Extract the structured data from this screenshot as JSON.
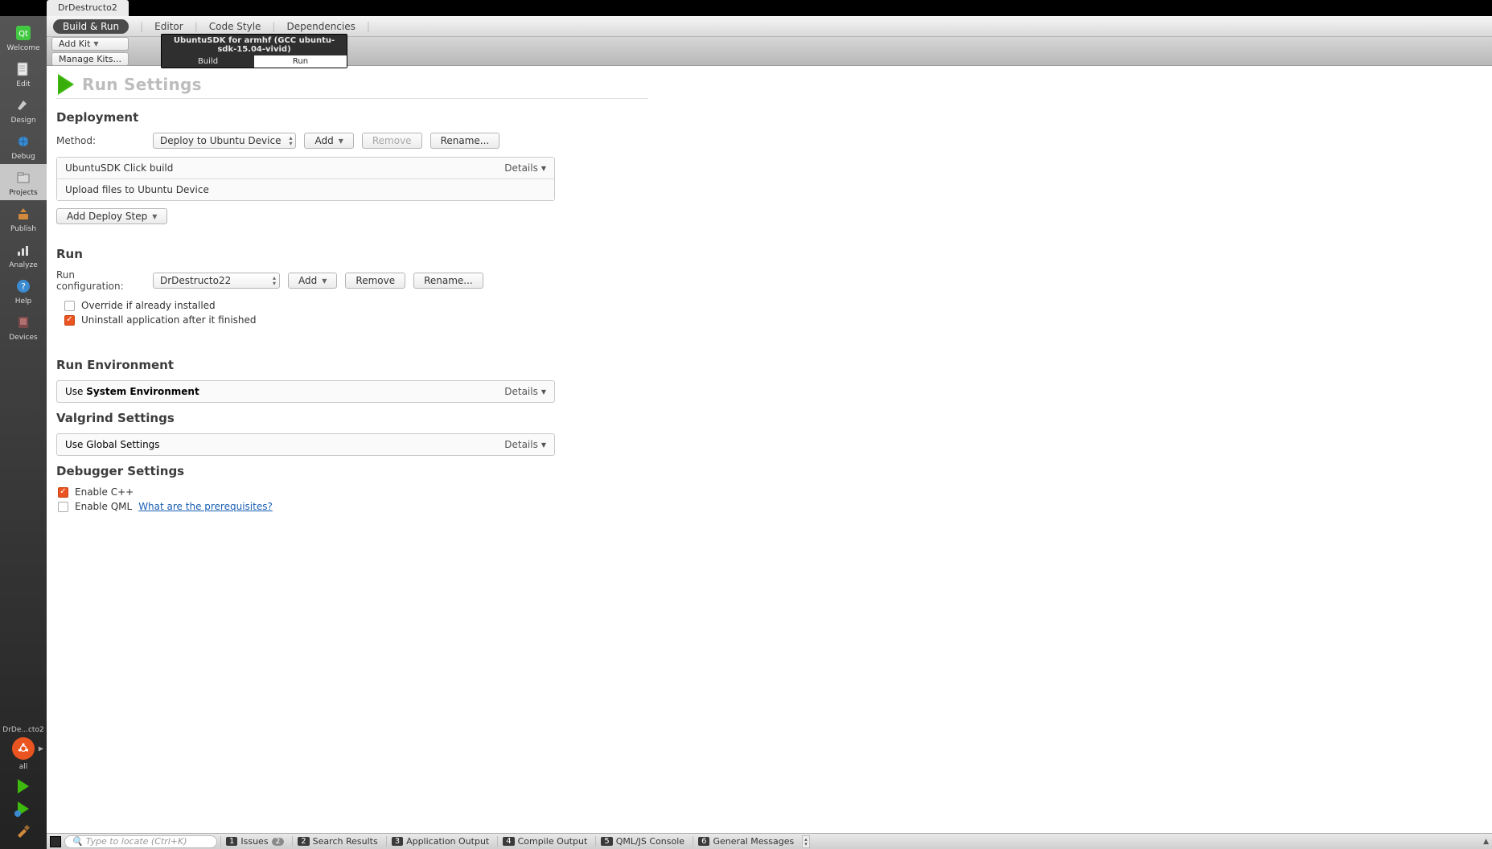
{
  "topbar": {
    "tab": "DrDestructo2"
  },
  "sidebar": {
    "items": [
      {
        "label": "Welcome",
        "icon": "qt-icon"
      },
      {
        "label": "Edit",
        "icon": "edit-icon"
      },
      {
        "label": "Design",
        "icon": "design-icon"
      },
      {
        "label": "Debug",
        "icon": "debug-icon"
      },
      {
        "label": "Projects",
        "icon": "projects-icon"
      },
      {
        "label": "Publish",
        "icon": "publish-icon"
      },
      {
        "label": "Analyze",
        "icon": "analyze-icon"
      },
      {
        "label": "Help",
        "icon": "help-icon"
      },
      {
        "label": "Devices",
        "icon": "devices-icon"
      }
    ],
    "project_short": "DrDe...cto2",
    "kit_label": "all"
  },
  "subtabs": {
    "active": "Build & Run",
    "items": [
      "Editor",
      "Code Style",
      "Dependencies"
    ]
  },
  "kits": {
    "add_kit": "Add Kit",
    "manage_kits": "Manage Kits...",
    "kit_title": "UbuntuSDK for armhf (GCC ubuntu-sdk-15.04-vivid)",
    "build_tab": "Build",
    "run_tab": "Run"
  },
  "page": {
    "title": "Run Settings",
    "deployment": {
      "heading": "Deployment",
      "method_label": "Method:",
      "method_value": "Deploy to Ubuntu Device",
      "add": "Add",
      "remove": "Remove",
      "rename": "Rename...",
      "steps": [
        "UbuntuSDK Click build",
        "Upload files to Ubuntu Device"
      ],
      "details": "Details",
      "add_step": "Add Deploy Step"
    },
    "run": {
      "heading": "Run",
      "config_label": "Run configuration:",
      "config_value": "DrDestructo22",
      "add": "Add",
      "remove": "Remove",
      "rename": "Rename...",
      "cb_override": "Override if already installed",
      "cb_uninstall": "Uninstall application after it finished"
    },
    "env": {
      "heading": "Run Environment",
      "use_prefix": "Use ",
      "use_bold": "System Environment",
      "details": "Details"
    },
    "valgrind": {
      "heading": "Valgrind Settings",
      "use": "Use Global Settings",
      "details": "Details"
    },
    "debugger": {
      "heading": "Debugger Settings",
      "cb_cpp": "Enable C++",
      "cb_qml": "Enable QML",
      "prereq": "What are the prerequisites?"
    }
  },
  "status": {
    "locate_placeholder": "Type to locate (Ctrl+K)",
    "panes": [
      {
        "n": "1",
        "label": "Issues",
        "badge": "2"
      },
      {
        "n": "2",
        "label": "Search Results"
      },
      {
        "n": "3",
        "label": "Application Output"
      },
      {
        "n": "4",
        "label": "Compile Output"
      },
      {
        "n": "5",
        "label": "QML/JS Console"
      },
      {
        "n": "6",
        "label": "General Messages"
      }
    ]
  }
}
